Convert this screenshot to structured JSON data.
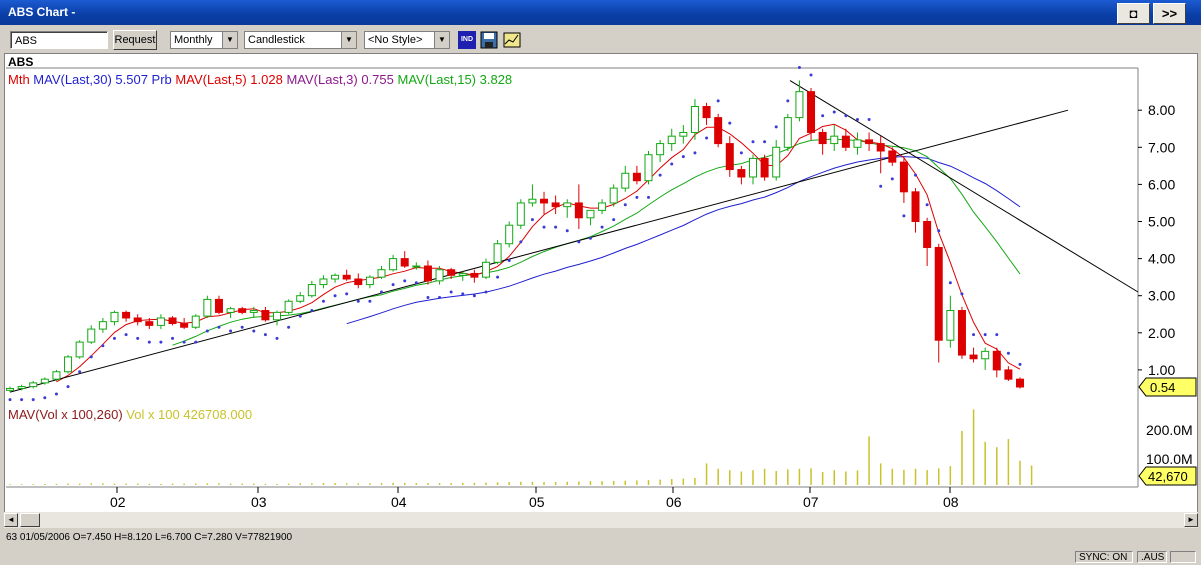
{
  "window": {
    "title": "ABS   Chart -",
    "btn_pin": "◘",
    "btn_next": ">>"
  },
  "toolbar": {
    "symbol": "ABS",
    "request_label": "Request",
    "period": "Monthly",
    "chart_style": "Candlestick",
    "style_preset": "<No Style>",
    "ind_label": "IND"
  },
  "chart_header": {
    "symbol": "ABS",
    "legend": [
      {
        "text": "Mth",
        "color": "#dd0000"
      },
      {
        "text": "MAV(Last,30)  5.507 Prb",
        "color": "#1f1fd0"
      },
      {
        "text": "MAV(Last,5)  1.028",
        "color": "#dd0000"
      },
      {
        "text": "MAV(Last,3)  0.755",
        "color": "#8b1a8b"
      },
      {
        "text": "MAV(Last,15)  3.828",
        "color": "#13a813"
      }
    ],
    "vol_legend": [
      {
        "text": "MAV(Vol x 100,260)",
        "color": "#8b1a1a"
      },
      {
        "text": "Vol x 100  426708.000",
        "color": "#c9c22a"
      }
    ]
  },
  "colors": {
    "up": "#13a813",
    "down": "#dd0000",
    "mav30": "#1f1fd0",
    "mav5": "#dd0000",
    "mav3": "#8b1a8b",
    "mav15": "#13a813",
    "psar": "#3b3bd6",
    "trend": "#000000",
    "volume": "#c9c22a"
  },
  "chart_data": {
    "type": "candlestick",
    "period": "Monthly",
    "y_ticks": [
      "8.00",
      "7.00",
      "6.00",
      "5.00",
      "4.00",
      "3.00",
      "2.00",
      "1.00"
    ],
    "y_range": [
      0,
      9
    ],
    "last_price_label": "0.54",
    "vol_ticks": [
      "200.0M",
      "100.0M"
    ],
    "last_vol_label": "42,670",
    "x_ticks": [
      "02",
      "03",
      "04",
      "05",
      "06",
      "07",
      "08"
    ],
    "candles": [
      [
        0.45,
        0.55,
        0.4,
        0.5
      ],
      [
        0.5,
        0.6,
        0.45,
        0.55
      ],
      [
        0.55,
        0.7,
        0.5,
        0.65
      ],
      [
        0.65,
        0.8,
        0.6,
        0.75
      ],
      [
        0.75,
        1.0,
        0.7,
        0.95
      ],
      [
        0.95,
        1.4,
        0.9,
        1.35
      ],
      [
        1.35,
        1.8,
        1.3,
        1.75
      ],
      [
        1.75,
        2.2,
        1.7,
        2.1
      ],
      [
        2.1,
        2.4,
        2.0,
        2.3
      ],
      [
        2.3,
        2.6,
        2.2,
        2.55
      ],
      [
        2.55,
        2.6,
        2.3,
        2.4
      ],
      [
        2.4,
        2.5,
        2.2,
        2.3
      ],
      [
        2.3,
        2.4,
        2.1,
        2.2
      ],
      [
        2.2,
        2.5,
        2.1,
        2.4
      ],
      [
        2.4,
        2.45,
        2.2,
        2.25
      ],
      [
        2.25,
        2.4,
        2.1,
        2.15
      ],
      [
        2.15,
        2.5,
        2.1,
        2.45
      ],
      [
        2.45,
        3.0,
        2.4,
        2.9
      ],
      [
        2.9,
        3.0,
        2.5,
        2.55
      ],
      [
        2.55,
        2.7,
        2.4,
        2.65
      ],
      [
        2.65,
        2.7,
        2.5,
        2.55
      ],
      [
        2.55,
        2.7,
        2.4,
        2.6
      ],
      [
        2.6,
        2.7,
        2.3,
        2.35
      ],
      [
        2.35,
        2.6,
        2.2,
        2.55
      ],
      [
        2.55,
        2.9,
        2.5,
        2.85
      ],
      [
        2.85,
        3.1,
        2.8,
        3.0
      ],
      [
        3.0,
        3.4,
        2.95,
        3.3
      ],
      [
        3.3,
        3.55,
        3.2,
        3.45
      ],
      [
        3.45,
        3.6,
        3.35,
        3.55
      ],
      [
        3.55,
        3.7,
        3.4,
        3.45
      ],
      [
        3.45,
        3.6,
        3.2,
        3.3
      ],
      [
        3.3,
        3.55,
        3.2,
        3.5
      ],
      [
        3.5,
        3.8,
        3.45,
        3.7
      ],
      [
        3.7,
        4.1,
        3.65,
        4.0
      ],
      [
        4.0,
        4.2,
        3.75,
        3.8
      ],
      [
        3.8,
        3.9,
        3.7,
        3.8
      ],
      [
        3.8,
        3.95,
        3.3,
        3.4
      ],
      [
        3.4,
        3.8,
        3.3,
        3.7
      ],
      [
        3.7,
        3.75,
        3.45,
        3.55
      ],
      [
        3.55,
        3.65,
        3.4,
        3.6
      ],
      [
        3.6,
        3.7,
        3.35,
        3.5
      ],
      [
        3.5,
        4.0,
        3.45,
        3.9
      ],
      [
        3.9,
        4.5,
        3.85,
        4.4
      ],
      [
        4.4,
        5.0,
        4.3,
        4.9
      ],
      [
        4.9,
        5.6,
        4.8,
        5.5
      ],
      [
        5.5,
        6.0,
        5.4,
        5.6
      ],
      [
        5.6,
        5.8,
        5.2,
        5.5
      ],
      [
        5.5,
        5.7,
        5.2,
        5.4
      ],
      [
        5.4,
        5.6,
        5.1,
        5.5
      ],
      [
        5.5,
        6.0,
        4.8,
        5.1
      ],
      [
        5.1,
        5.3,
        4.9,
        5.3
      ],
      [
        5.3,
        5.6,
        5.2,
        5.5
      ],
      [
        5.5,
        6.0,
        5.4,
        5.9
      ],
      [
        5.9,
        6.5,
        5.8,
        6.3
      ],
      [
        6.3,
        6.5,
        6.0,
        6.1
      ],
      [
        6.1,
        6.9,
        6.0,
        6.8
      ],
      [
        6.8,
        7.2,
        6.6,
        7.1
      ],
      [
        7.1,
        7.5,
        6.9,
        7.3
      ],
      [
        7.3,
        7.6,
        7.1,
        7.4
      ],
      [
        7.4,
        8.3,
        7.2,
        8.1
      ],
      [
        8.1,
        8.2,
        7.6,
        7.8
      ],
      [
        7.8,
        7.9,
        7.0,
        7.1
      ],
      [
        7.1,
        7.3,
        6.2,
        6.4
      ],
      [
        6.4,
        6.5,
        6.0,
        6.2
      ],
      [
        6.2,
        6.8,
        6.0,
        6.7
      ],
      [
        6.7,
        6.8,
        6.1,
        6.2
      ],
      [
        6.2,
        7.2,
        6.1,
        7.0
      ],
      [
        7.0,
        7.9,
        6.9,
        7.8
      ],
      [
        7.8,
        8.8,
        7.7,
        8.5
      ],
      [
        8.5,
        8.6,
        7.2,
        7.4
      ],
      [
        7.4,
        7.5,
        6.8,
        7.1
      ],
      [
        7.1,
        7.6,
        6.9,
        7.3
      ],
      [
        7.3,
        7.5,
        6.9,
        7.0
      ],
      [
        7.0,
        7.4,
        6.8,
        7.2
      ],
      [
        7.2,
        7.4,
        6.9,
        7.1
      ],
      [
        7.1,
        7.3,
        6.3,
        6.9
      ],
      [
        6.9,
        7.0,
        6.5,
        6.6
      ],
      [
        6.6,
        6.7,
        5.5,
        5.8
      ],
      [
        5.8,
        5.9,
        4.7,
        5.0
      ],
      [
        5.0,
        5.1,
        3.8,
        4.3
      ],
      [
        4.3,
        4.4,
        1.2,
        1.8
      ],
      [
        1.8,
        3.0,
        1.6,
        2.6
      ],
      [
        2.6,
        2.7,
        1.3,
        1.4
      ],
      [
        1.4,
        1.6,
        1.2,
        1.3
      ],
      [
        1.3,
        1.6,
        1.0,
        1.5
      ],
      [
        1.5,
        1.6,
        0.8,
        1.0
      ],
      [
        1.0,
        1.1,
        0.7,
        0.75
      ],
      [
        0.75,
        0.8,
        0.5,
        0.54
      ]
    ],
    "volume": [
      3,
      3,
      3,
      4,
      4,
      5,
      5,
      6,
      6,
      5,
      5,
      5,
      4,
      4,
      5,
      5,
      5,
      6,
      6,
      5,
      5,
      5,
      4,
      4,
      5,
      6,
      6,
      7,
      7,
      6,
      6,
      6,
      7,
      8,
      8,
      7,
      7,
      7,
      7,
      8,
      8,
      9,
      10,
      11,
      12,
      12,
      11,
      11,
      12,
      13,
      14,
      14,
      15,
      16,
      17,
      18,
      20,
      22,
      24,
      26,
      80,
      60,
      55,
      50,
      55,
      60,
      52,
      58,
      60,
      62,
      48,
      55,
      50,
      54,
      180,
      80,
      60,
      56,
      60,
      55,
      62,
      70,
      200,
      280,
      160,
      140,
      170,
      90,
      72
    ],
    "trendlines": [
      {
        "from": [
          "01-06",
          0.4
        ],
        "to": [
          "08-09",
          8.0
        ]
      },
      {
        "from": [
          "06-11",
          8.8
        ],
        "to": [
          "08-12",
          3.1
        ]
      }
    ],
    "status": {
      "bar": "63",
      "date": "01/05/2006",
      "o": "7.450",
      "h": "8.120",
      "l": "6.700",
      "c": "7.280",
      "v": "77821900"
    }
  },
  "statusbar": {
    "text": "63   01/05/2006  O=7.450  H=8.120  L=6.700  C=7.280  V=77821900"
  },
  "bottombar": {
    "sync": "SYNC: ON",
    "market": ".AUS"
  }
}
